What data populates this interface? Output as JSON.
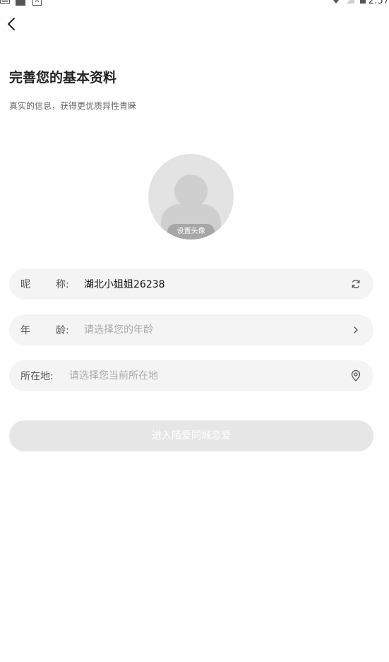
{
  "status_bar": {
    "time": "2:57",
    "a_label": "A"
  },
  "header": {
    "title": "完善您的基本资料",
    "subtitle": "真实的信息，获得更优质异性青睐"
  },
  "avatar": {
    "label": "设置头像"
  },
  "form": {
    "nickname": {
      "label_a": "昵",
      "label_b": "称:",
      "value": "湖北小姐姐26238"
    },
    "age": {
      "label_a": "年",
      "label_b": "龄:",
      "placeholder": "请选择您的年龄"
    },
    "location": {
      "label": "所在地:",
      "placeholder": "请选择您当前所在地"
    }
  },
  "submit": {
    "label": "进入陌爱同城恋爱"
  },
  "colors": {
    "field_bg": "#f4f4f4",
    "button_bg": "#e6e6e6",
    "avatar_bg": "#e3e3e3"
  },
  "icons": {
    "back": "chevron-left-icon",
    "refresh": "refresh-icon",
    "arrow": "chevron-right-icon",
    "location": "location-pin-icon"
  }
}
